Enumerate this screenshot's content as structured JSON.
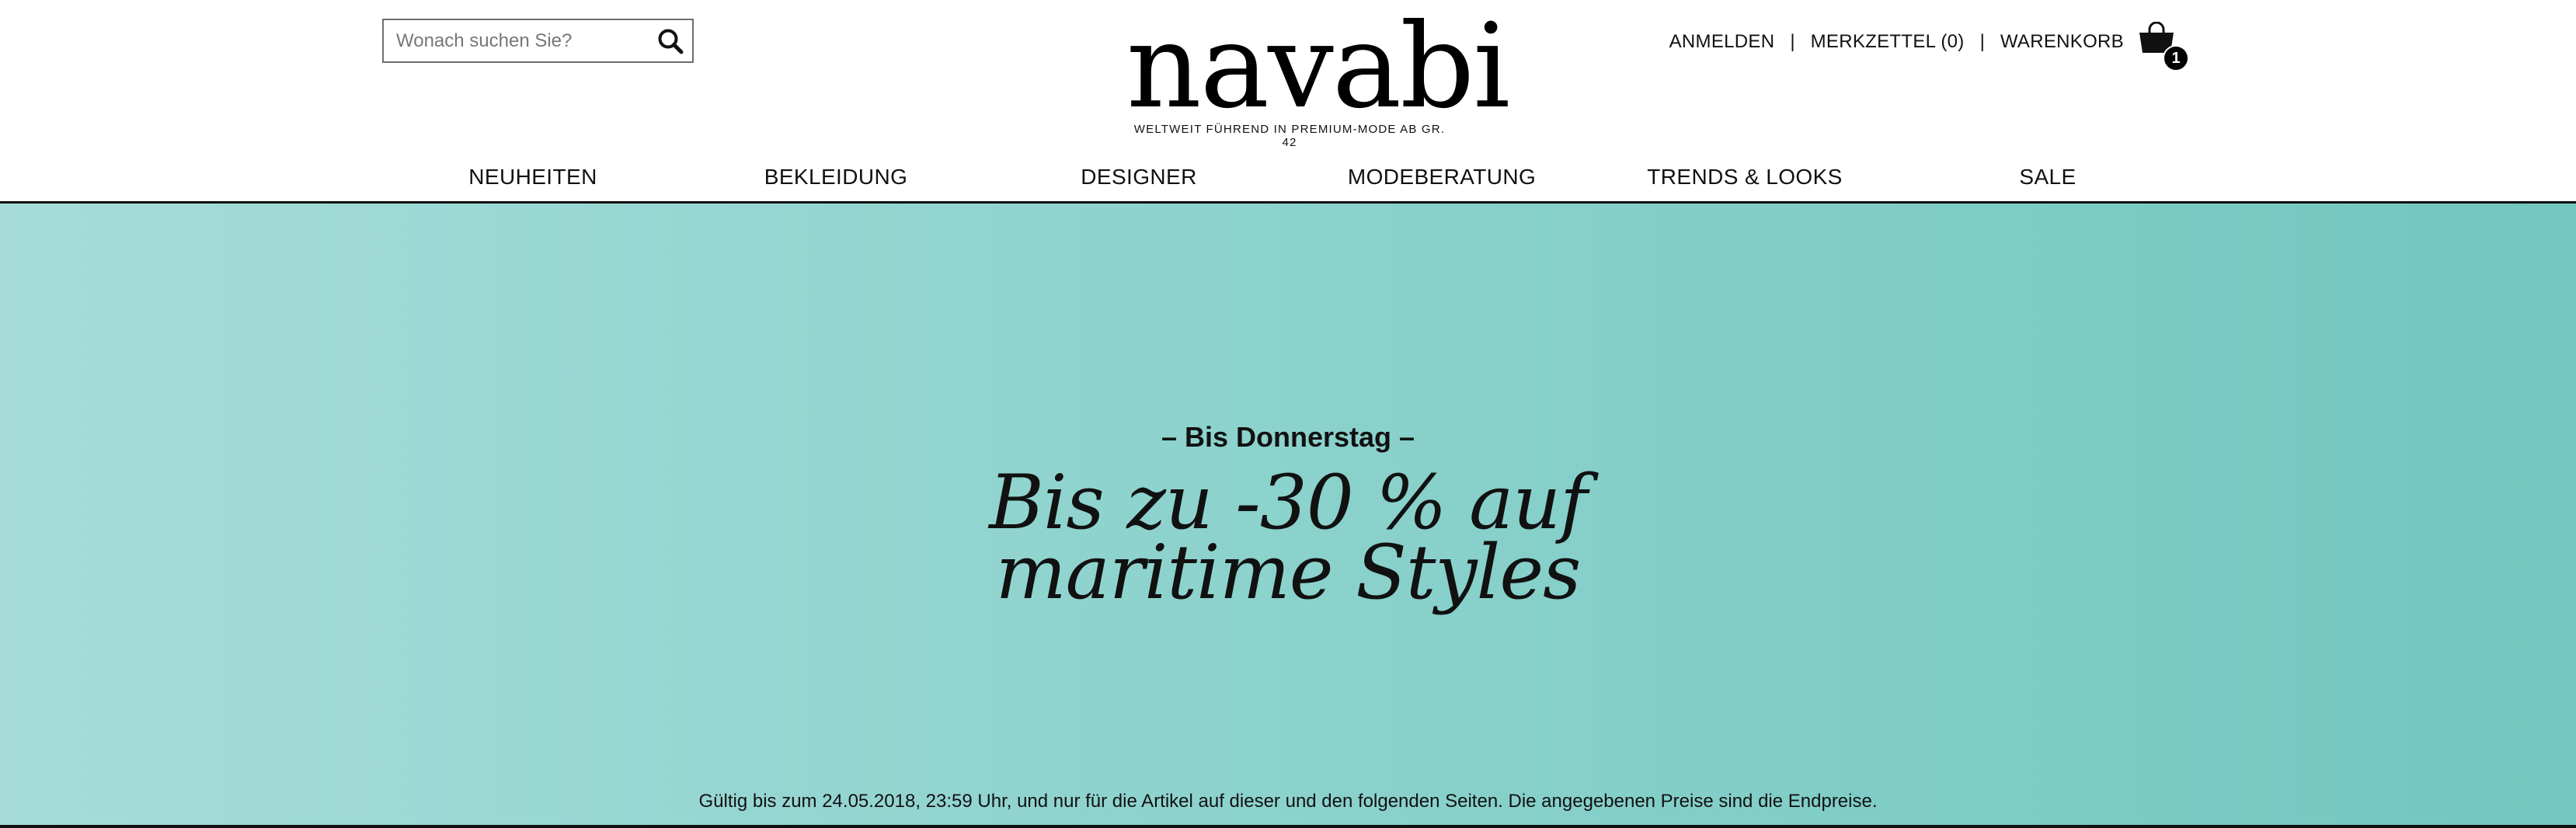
{
  "search": {
    "placeholder": "Wonach suchen Sie?"
  },
  "logo": {
    "word": "navabi",
    "tagline": "WELTWEIT FÜHREND IN PREMIUM-MODE AB GR. 42"
  },
  "account": {
    "login": "ANMELDEN",
    "wishlist": "MERKZETTEL (0)",
    "cart": "WARENKORB",
    "cart_count": "1",
    "separator": "|"
  },
  "nav": {
    "items": [
      {
        "label": "NEUHEITEN"
      },
      {
        "label": "BEKLEIDUNG"
      },
      {
        "label": "DESIGNER"
      },
      {
        "label": "MODEBERATUNG"
      },
      {
        "label": "TRENDS & LOOKS"
      },
      {
        "label": "SALE"
      }
    ]
  },
  "hero": {
    "kicker": "– Bis Donnerstag –",
    "title_line1": "Bis zu -30 % auf",
    "title_line2": "maritime Styles",
    "note": "Gültig bis zum 24.05.2018, 23:59 Uhr, und nur für die Artikel auf dieser und den folgenden Seiten. Die angegebenen Preise sind die Endpreise.",
    "bg_start": "#a5dcd9",
    "bg_end": "#72c7c0"
  }
}
